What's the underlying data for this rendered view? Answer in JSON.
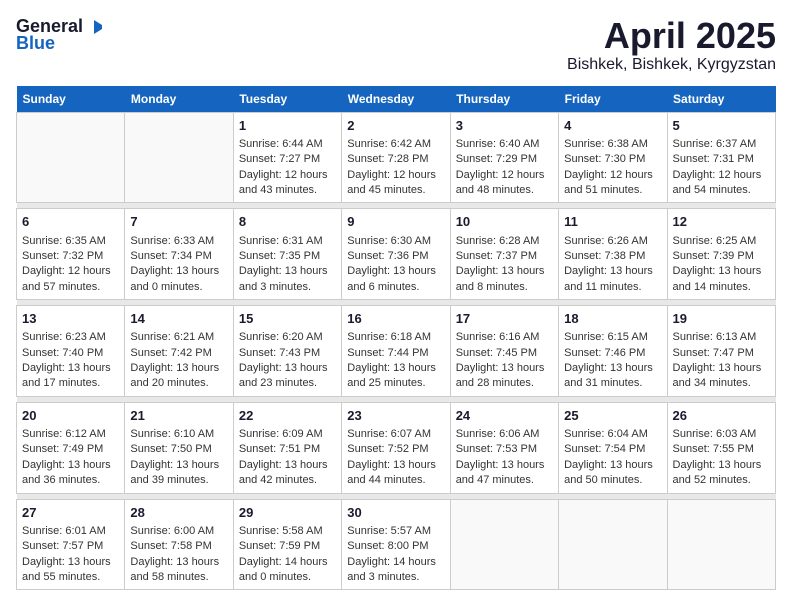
{
  "header": {
    "logo_general": "General",
    "logo_blue": "Blue",
    "title": "April 2025",
    "subtitle": "Bishkek, Bishkek, Kyrgyzstan"
  },
  "days_of_week": [
    "Sunday",
    "Monday",
    "Tuesday",
    "Wednesday",
    "Thursday",
    "Friday",
    "Saturday"
  ],
  "weeks": [
    {
      "days": [
        {
          "num": "",
          "empty": true
        },
        {
          "num": "",
          "empty": true
        },
        {
          "num": "1",
          "sunrise": "Sunrise: 6:44 AM",
          "sunset": "Sunset: 7:27 PM",
          "daylight": "Daylight: 12 hours and 43 minutes."
        },
        {
          "num": "2",
          "sunrise": "Sunrise: 6:42 AM",
          "sunset": "Sunset: 7:28 PM",
          "daylight": "Daylight: 12 hours and 45 minutes."
        },
        {
          "num": "3",
          "sunrise": "Sunrise: 6:40 AM",
          "sunset": "Sunset: 7:29 PM",
          "daylight": "Daylight: 12 hours and 48 minutes."
        },
        {
          "num": "4",
          "sunrise": "Sunrise: 6:38 AM",
          "sunset": "Sunset: 7:30 PM",
          "daylight": "Daylight: 12 hours and 51 minutes."
        },
        {
          "num": "5",
          "sunrise": "Sunrise: 6:37 AM",
          "sunset": "Sunset: 7:31 PM",
          "daylight": "Daylight: 12 hours and 54 minutes."
        }
      ]
    },
    {
      "days": [
        {
          "num": "6",
          "sunrise": "Sunrise: 6:35 AM",
          "sunset": "Sunset: 7:32 PM",
          "daylight": "Daylight: 12 hours and 57 minutes."
        },
        {
          "num": "7",
          "sunrise": "Sunrise: 6:33 AM",
          "sunset": "Sunset: 7:34 PM",
          "daylight": "Daylight: 13 hours and 0 minutes."
        },
        {
          "num": "8",
          "sunrise": "Sunrise: 6:31 AM",
          "sunset": "Sunset: 7:35 PM",
          "daylight": "Daylight: 13 hours and 3 minutes."
        },
        {
          "num": "9",
          "sunrise": "Sunrise: 6:30 AM",
          "sunset": "Sunset: 7:36 PM",
          "daylight": "Daylight: 13 hours and 6 minutes."
        },
        {
          "num": "10",
          "sunrise": "Sunrise: 6:28 AM",
          "sunset": "Sunset: 7:37 PM",
          "daylight": "Daylight: 13 hours and 8 minutes."
        },
        {
          "num": "11",
          "sunrise": "Sunrise: 6:26 AM",
          "sunset": "Sunset: 7:38 PM",
          "daylight": "Daylight: 13 hours and 11 minutes."
        },
        {
          "num": "12",
          "sunrise": "Sunrise: 6:25 AM",
          "sunset": "Sunset: 7:39 PM",
          "daylight": "Daylight: 13 hours and 14 minutes."
        }
      ]
    },
    {
      "days": [
        {
          "num": "13",
          "sunrise": "Sunrise: 6:23 AM",
          "sunset": "Sunset: 7:40 PM",
          "daylight": "Daylight: 13 hours and 17 minutes."
        },
        {
          "num": "14",
          "sunrise": "Sunrise: 6:21 AM",
          "sunset": "Sunset: 7:42 PM",
          "daylight": "Daylight: 13 hours and 20 minutes."
        },
        {
          "num": "15",
          "sunrise": "Sunrise: 6:20 AM",
          "sunset": "Sunset: 7:43 PM",
          "daylight": "Daylight: 13 hours and 23 minutes."
        },
        {
          "num": "16",
          "sunrise": "Sunrise: 6:18 AM",
          "sunset": "Sunset: 7:44 PM",
          "daylight": "Daylight: 13 hours and 25 minutes."
        },
        {
          "num": "17",
          "sunrise": "Sunrise: 6:16 AM",
          "sunset": "Sunset: 7:45 PM",
          "daylight": "Daylight: 13 hours and 28 minutes."
        },
        {
          "num": "18",
          "sunrise": "Sunrise: 6:15 AM",
          "sunset": "Sunset: 7:46 PM",
          "daylight": "Daylight: 13 hours and 31 minutes."
        },
        {
          "num": "19",
          "sunrise": "Sunrise: 6:13 AM",
          "sunset": "Sunset: 7:47 PM",
          "daylight": "Daylight: 13 hours and 34 minutes."
        }
      ]
    },
    {
      "days": [
        {
          "num": "20",
          "sunrise": "Sunrise: 6:12 AM",
          "sunset": "Sunset: 7:49 PM",
          "daylight": "Daylight: 13 hours and 36 minutes."
        },
        {
          "num": "21",
          "sunrise": "Sunrise: 6:10 AM",
          "sunset": "Sunset: 7:50 PM",
          "daylight": "Daylight: 13 hours and 39 minutes."
        },
        {
          "num": "22",
          "sunrise": "Sunrise: 6:09 AM",
          "sunset": "Sunset: 7:51 PM",
          "daylight": "Daylight: 13 hours and 42 minutes."
        },
        {
          "num": "23",
          "sunrise": "Sunrise: 6:07 AM",
          "sunset": "Sunset: 7:52 PM",
          "daylight": "Daylight: 13 hours and 44 minutes."
        },
        {
          "num": "24",
          "sunrise": "Sunrise: 6:06 AM",
          "sunset": "Sunset: 7:53 PM",
          "daylight": "Daylight: 13 hours and 47 minutes."
        },
        {
          "num": "25",
          "sunrise": "Sunrise: 6:04 AM",
          "sunset": "Sunset: 7:54 PM",
          "daylight": "Daylight: 13 hours and 50 minutes."
        },
        {
          "num": "26",
          "sunrise": "Sunrise: 6:03 AM",
          "sunset": "Sunset: 7:55 PM",
          "daylight": "Daylight: 13 hours and 52 minutes."
        }
      ]
    },
    {
      "days": [
        {
          "num": "27",
          "sunrise": "Sunrise: 6:01 AM",
          "sunset": "Sunset: 7:57 PM",
          "daylight": "Daylight: 13 hours and 55 minutes."
        },
        {
          "num": "28",
          "sunrise": "Sunrise: 6:00 AM",
          "sunset": "Sunset: 7:58 PM",
          "daylight": "Daylight: 13 hours and 58 minutes."
        },
        {
          "num": "29",
          "sunrise": "Sunrise: 5:58 AM",
          "sunset": "Sunset: 7:59 PM",
          "daylight": "Daylight: 14 hours and 0 minutes."
        },
        {
          "num": "30",
          "sunrise": "Sunrise: 5:57 AM",
          "sunset": "Sunset: 8:00 PM",
          "daylight": "Daylight: 14 hours and 3 minutes."
        },
        {
          "num": "",
          "empty": true
        },
        {
          "num": "",
          "empty": true
        },
        {
          "num": "",
          "empty": true
        }
      ]
    }
  ]
}
